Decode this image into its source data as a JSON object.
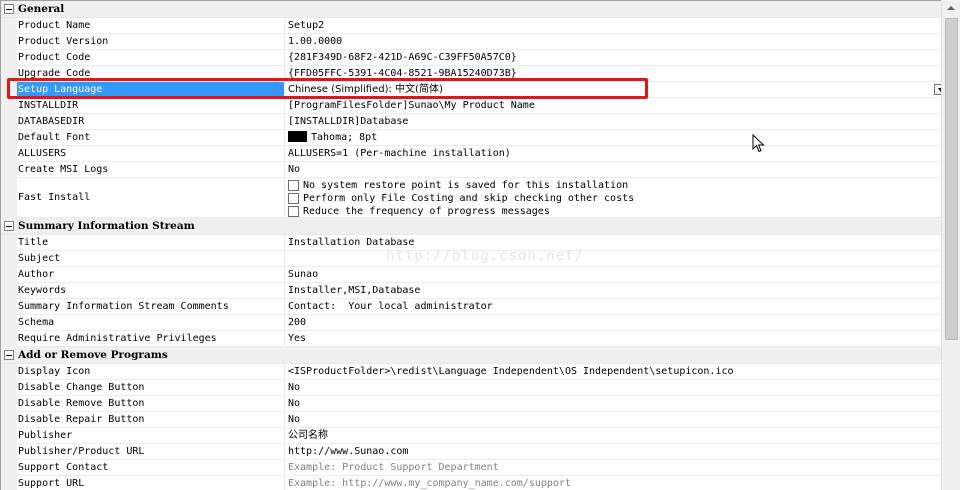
{
  "sections": {
    "general": {
      "title": "General",
      "rows": [
        {
          "name": "Product Name",
          "value": "Setup2"
        },
        {
          "name": "Product Version",
          "value": "1.00.0000"
        },
        {
          "name": "Product Code",
          "value": "{281F349D-68F2-421D-A69C-C39FF50A57C0}"
        },
        {
          "name": "Upgrade Code",
          "value": "{FFD05FFC-5391-4C04-8521-9BA15240D73B}"
        },
        {
          "name": "Setup Language",
          "value": "Chinese (Simplified): 中文(简体)"
        },
        {
          "name": "INSTALLDIR",
          "value": "[ProgramFilesFolder]Sunao\\My Product Name"
        },
        {
          "name": "DATABASEDIR",
          "value": "[INSTALLDIR]Database"
        },
        {
          "name": "Default Font",
          "value": "Tahoma; 8pt"
        },
        {
          "name": "ALLUSERS",
          "value": "ALLUSERS=1 (Per-machine installation)"
        },
        {
          "name": "Create MSI Logs",
          "value": "No"
        }
      ],
      "fast_install": {
        "name": "Fast Install",
        "options": [
          "No system restore point is saved for this installation",
          "Perform only File Costing and skip checking other costs",
          "Reduce the frequency of progress messages"
        ]
      }
    },
    "summary": {
      "title": "Summary Information Stream",
      "rows": [
        {
          "name": "Title",
          "value": "Installation Database"
        },
        {
          "name": "Subject",
          "value": ""
        },
        {
          "name": "Author",
          "value": "Sunao"
        },
        {
          "name": "Keywords",
          "value": "Installer,MSI,Database"
        },
        {
          "name": "Summary Information Stream Comments",
          "value": "Contact:  Your local administrator"
        },
        {
          "name": "Schema",
          "value": "200"
        },
        {
          "name": "Require Administrative Privileges",
          "value": "Yes"
        }
      ]
    },
    "arp": {
      "title": "Add or Remove Programs",
      "rows": [
        {
          "name": "Display Icon",
          "value": "<ISProductFolder>\\redist\\Language Independent\\OS Independent\\setupicon.ico"
        },
        {
          "name": "Disable Change Button",
          "value": "No"
        },
        {
          "name": "Disable Remove Button",
          "value": "No"
        },
        {
          "name": "Disable Repair Button",
          "value": "No"
        },
        {
          "name": "Publisher",
          "value": "公司名称"
        },
        {
          "name": "Publisher/Product URL",
          "value": "http://www.Sunao.com"
        },
        {
          "name": "Support Contact",
          "value": "Example: Product Support Department"
        },
        {
          "name": "Support URL",
          "value": "Example: http://www.my_company_name.com/support"
        }
      ]
    }
  },
  "watermark": "http://blog.csdn.net/",
  "colors": {
    "selection": "#3399ff",
    "highlight_border": "#e0161b",
    "placeholder_text": "#808080"
  }
}
